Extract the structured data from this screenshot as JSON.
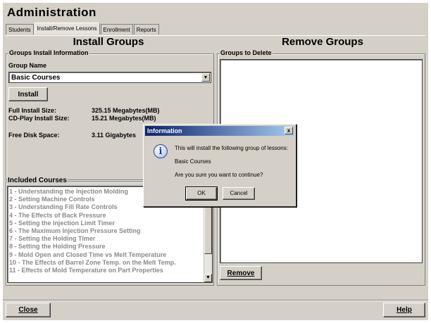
{
  "window": {
    "title": "Administration"
  },
  "tabs": [
    "Students",
    "Install/Remove Lessons",
    "Enrollment",
    "Reports"
  ],
  "install": {
    "heading": "Install Groups",
    "info_legend": "Groups Install Information",
    "group_name_label": "Group Name",
    "group_name_value": "Basic Courses",
    "install_button": "Install",
    "full_size_label": "Full Install Size:",
    "full_size_value": "325.15 Megabytes(MB)",
    "cd_size_label": "CD-Play Install Size:",
    "cd_size_value": "15.21 Megabytes(MB)",
    "free_disk_label": "Free Disk Space:",
    "free_disk_value": "3.11 Gigabytes"
  },
  "included": {
    "legend": "Included Courses",
    "items": [
      "1 - Understanding the Injection Molding",
      "2 - Setting Machine Controls",
      "3 - Understanding Fill Rate Controls",
      "4 - The Effects of Back Pressure",
      "5 - Setting the Injection Limit Timer",
      "6 - The Maximum Injection Pressure Setting",
      "7 - Setting the Holding Timer",
      "8 - Setting the Holding Pressure",
      "9 - Mold Open and Closed Time vs Melt Temperature",
      "10 - The Effects of Barrel Zone Temp. on the Melt Temp.",
      "11 - Effects of Mold Temperature on Part Properties"
    ]
  },
  "remove": {
    "heading": "Remove Groups",
    "legend": "Groups to Delete",
    "remove_button": "Remove"
  },
  "footer": {
    "close_button": "Close",
    "help_button": "Help"
  },
  "dialog": {
    "title": "Information",
    "close": "x",
    "line1": "This will install the following group of lessons:",
    "line2": "Basic Courses",
    "line3": "Are you sure you want to continue?",
    "ok": "OK",
    "cancel": "Cancel",
    "icon": "i"
  }
}
